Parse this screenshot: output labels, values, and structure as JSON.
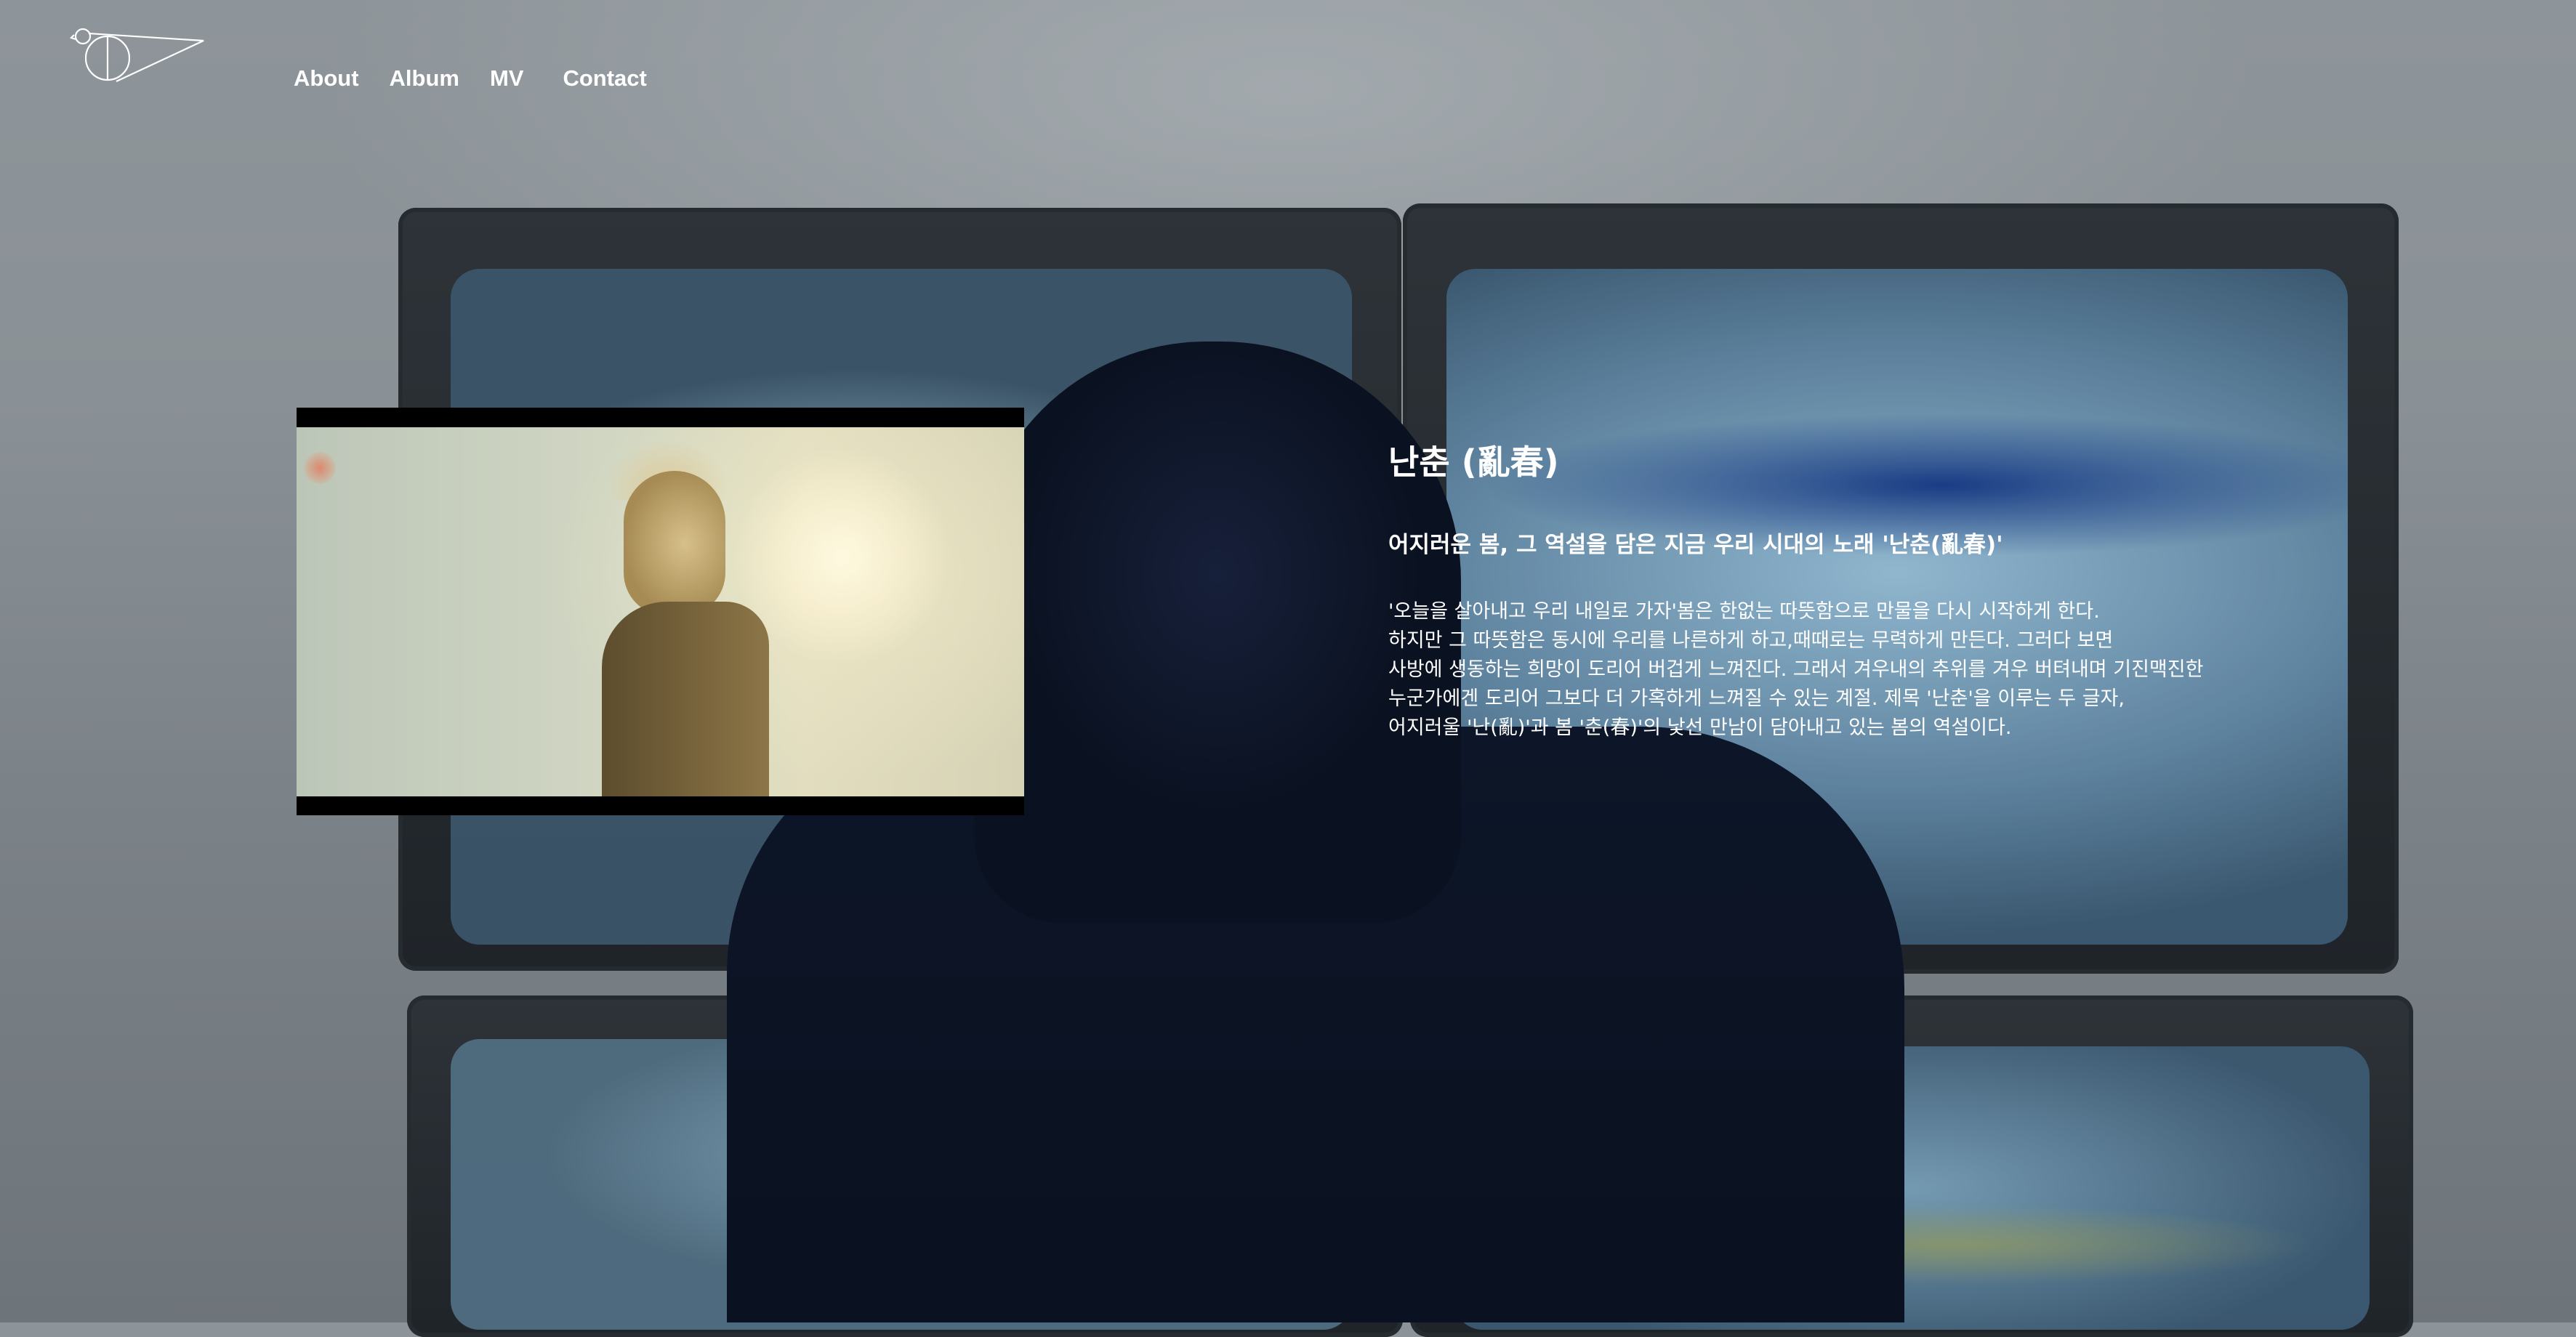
{
  "header": {
    "logo": {
      "name": "bird-logo",
      "stroke_color": "#ffffff"
    },
    "nav": [
      "About",
      "Album",
      "MV",
      "Contact"
    ]
  },
  "video": {
    "thumbnail": "music video still: silhouetted figure in warm backlight"
  },
  "content": {
    "title": "난춘 (亂春)",
    "subtitle": "어지러운 봄, 그 역설을 담은 지금 우리 시대의 노래 '난춘(亂春)'",
    "description": [
      "'오늘을 살아내고 우리 내일로 가자'봄은 한없는 따뜻함으로 만물을 다시 시작하게 한다.",
      "하지만 그 따뜻함은 동시에 우리를 나른하게 하고,때때로는 무력하게 만든다. 그러다 보면",
      "사방에 생동하는 희망이 도리어 버겁게 느껴진다. 그래서 겨우내의 추위를 겨우 버텨내며 기진맥진한",
      "누군가에겐 도리어 그보다 더 가혹하게 느껴질 수 있는 계절. 제목 '난춘'을 이루는 두 글자,",
      "어지러울 '난(亂)'과 봄 '춘(春)'의 낯선 만남이 담아내고 있는 봄의 역설이다."
    ]
  },
  "colors": {
    "text": "#ffffff",
    "background": "#8d9499",
    "figure": "#0b1324"
  }
}
